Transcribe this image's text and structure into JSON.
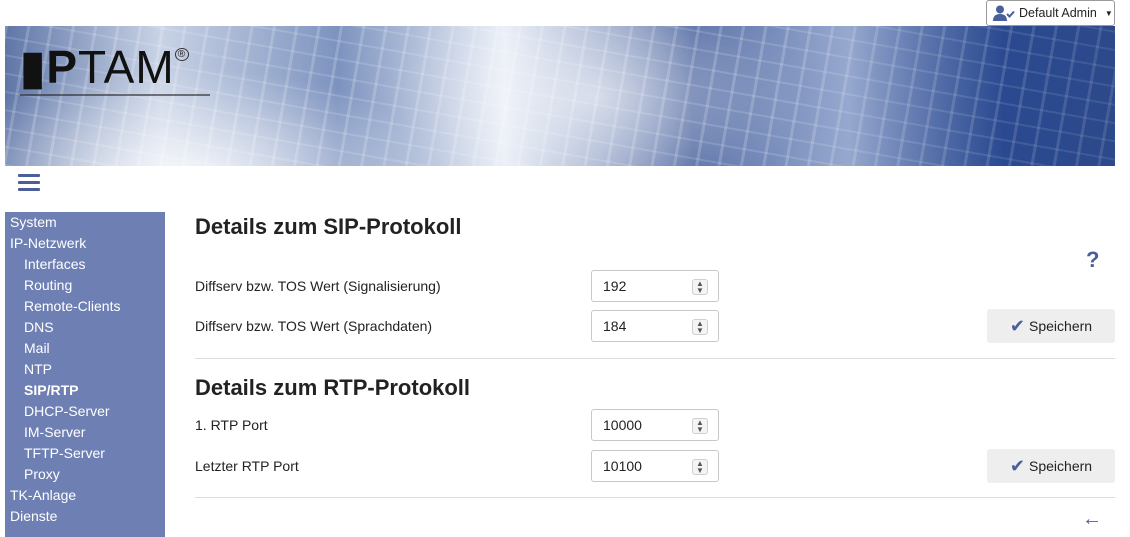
{
  "header": {
    "user_label": "Default Admin",
    "logo_text": "IPTAM",
    "user_icon": "user-check-icon"
  },
  "sidebar": {
    "items": [
      {
        "label": "System",
        "level": 0,
        "active": false
      },
      {
        "label": "IP-Netzwerk",
        "level": 0,
        "active": false
      },
      {
        "label": "Interfaces",
        "level": 1,
        "active": false
      },
      {
        "label": "Routing",
        "level": 1,
        "active": false
      },
      {
        "label": "Remote-Clients",
        "level": 1,
        "active": false
      },
      {
        "label": "DNS",
        "level": 1,
        "active": false
      },
      {
        "label": "Mail",
        "level": 1,
        "active": false
      },
      {
        "label": "NTP",
        "level": 1,
        "active": false
      },
      {
        "label": "SIP/RTP",
        "level": 1,
        "active": true
      },
      {
        "label": "DHCP-Server",
        "level": 1,
        "active": false
      },
      {
        "label": "IM-Server",
        "level": 1,
        "active": false
      },
      {
        "label": "TFTP-Server",
        "level": 1,
        "active": false
      },
      {
        "label": "Proxy",
        "level": 1,
        "active": false
      },
      {
        "label": "TK-Anlage",
        "level": 0,
        "active": false
      },
      {
        "label": "Dienste",
        "level": 0,
        "active": false
      }
    ]
  },
  "sip": {
    "title": "Details zum SIP-Protokoll",
    "signal_label": "Diffserv bzw. TOS Wert (Signalisierung)",
    "signal_value": "192",
    "voice_label": "Diffserv bzw. TOS Wert (Sprachdaten)",
    "voice_value": "184",
    "save_label": "Speichern"
  },
  "rtp": {
    "title": "Details zum RTP-Protokoll",
    "first_port_label": "1. RTP Port",
    "first_port_value": "10000",
    "last_port_label": "Letzter RTP Port",
    "last_port_value": "10100",
    "save_label": "Speichern"
  },
  "icons": {
    "help": "?",
    "back": "←",
    "check": "✔",
    "spin": "⌃⌄"
  },
  "colors": {
    "accent": "#4a5e9a",
    "sidebar_bg": "#6e80b3",
    "button_bg": "#eeeeee"
  }
}
